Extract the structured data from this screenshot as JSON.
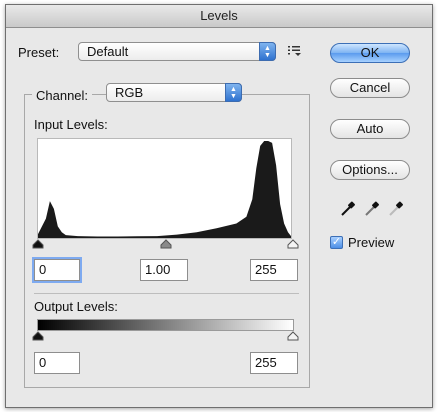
{
  "window": {
    "title": "Levels"
  },
  "preset": {
    "label": "Preset:",
    "value": "Default",
    "menu_icon": "preset-options-icon"
  },
  "channel": {
    "label": "Channel:",
    "value": "RGB"
  },
  "input_levels": {
    "label": "Input Levels:",
    "black": "0",
    "gamma": "1.00",
    "white": "255"
  },
  "output_levels": {
    "label": "Output Levels:",
    "black": "0",
    "white": "255"
  },
  "buttons": {
    "ok": "OK",
    "cancel": "Cancel",
    "auto": "Auto",
    "options": "Options..."
  },
  "preview": {
    "label": "Preview",
    "checked": true
  },
  "icons": {
    "eyedroppers": [
      "black-point-eyedropper-icon",
      "gray-point-eyedropper-icon",
      "white-point-eyedropper-icon"
    ]
  },
  "colors": {
    "default_button": "#5a9bee",
    "histogram_fill": "#1a1a1a"
  },
  "chart_data": {
    "type": "area",
    "x": [
      0,
      8,
      12,
      16,
      20,
      24,
      28,
      40,
      60,
      80,
      100,
      120,
      140,
      160,
      180,
      200,
      210,
      216,
      220,
      224,
      228,
      232,
      236,
      240,
      244,
      248,
      252,
      255
    ],
    "values": [
      0.04,
      0.2,
      0.38,
      0.3,
      0.12,
      0.06,
      0.03,
      0.02,
      0.015,
      0.015,
      0.018,
      0.02,
      0.035,
      0.06,
      0.1,
      0.15,
      0.22,
      0.4,
      0.72,
      0.95,
      1.0,
      1.0,
      0.98,
      0.75,
      0.35,
      0.15,
      0.06,
      0.02
    ],
    "xlim": [
      0,
      255
    ],
    "ylim": [
      0,
      1
    ]
  }
}
